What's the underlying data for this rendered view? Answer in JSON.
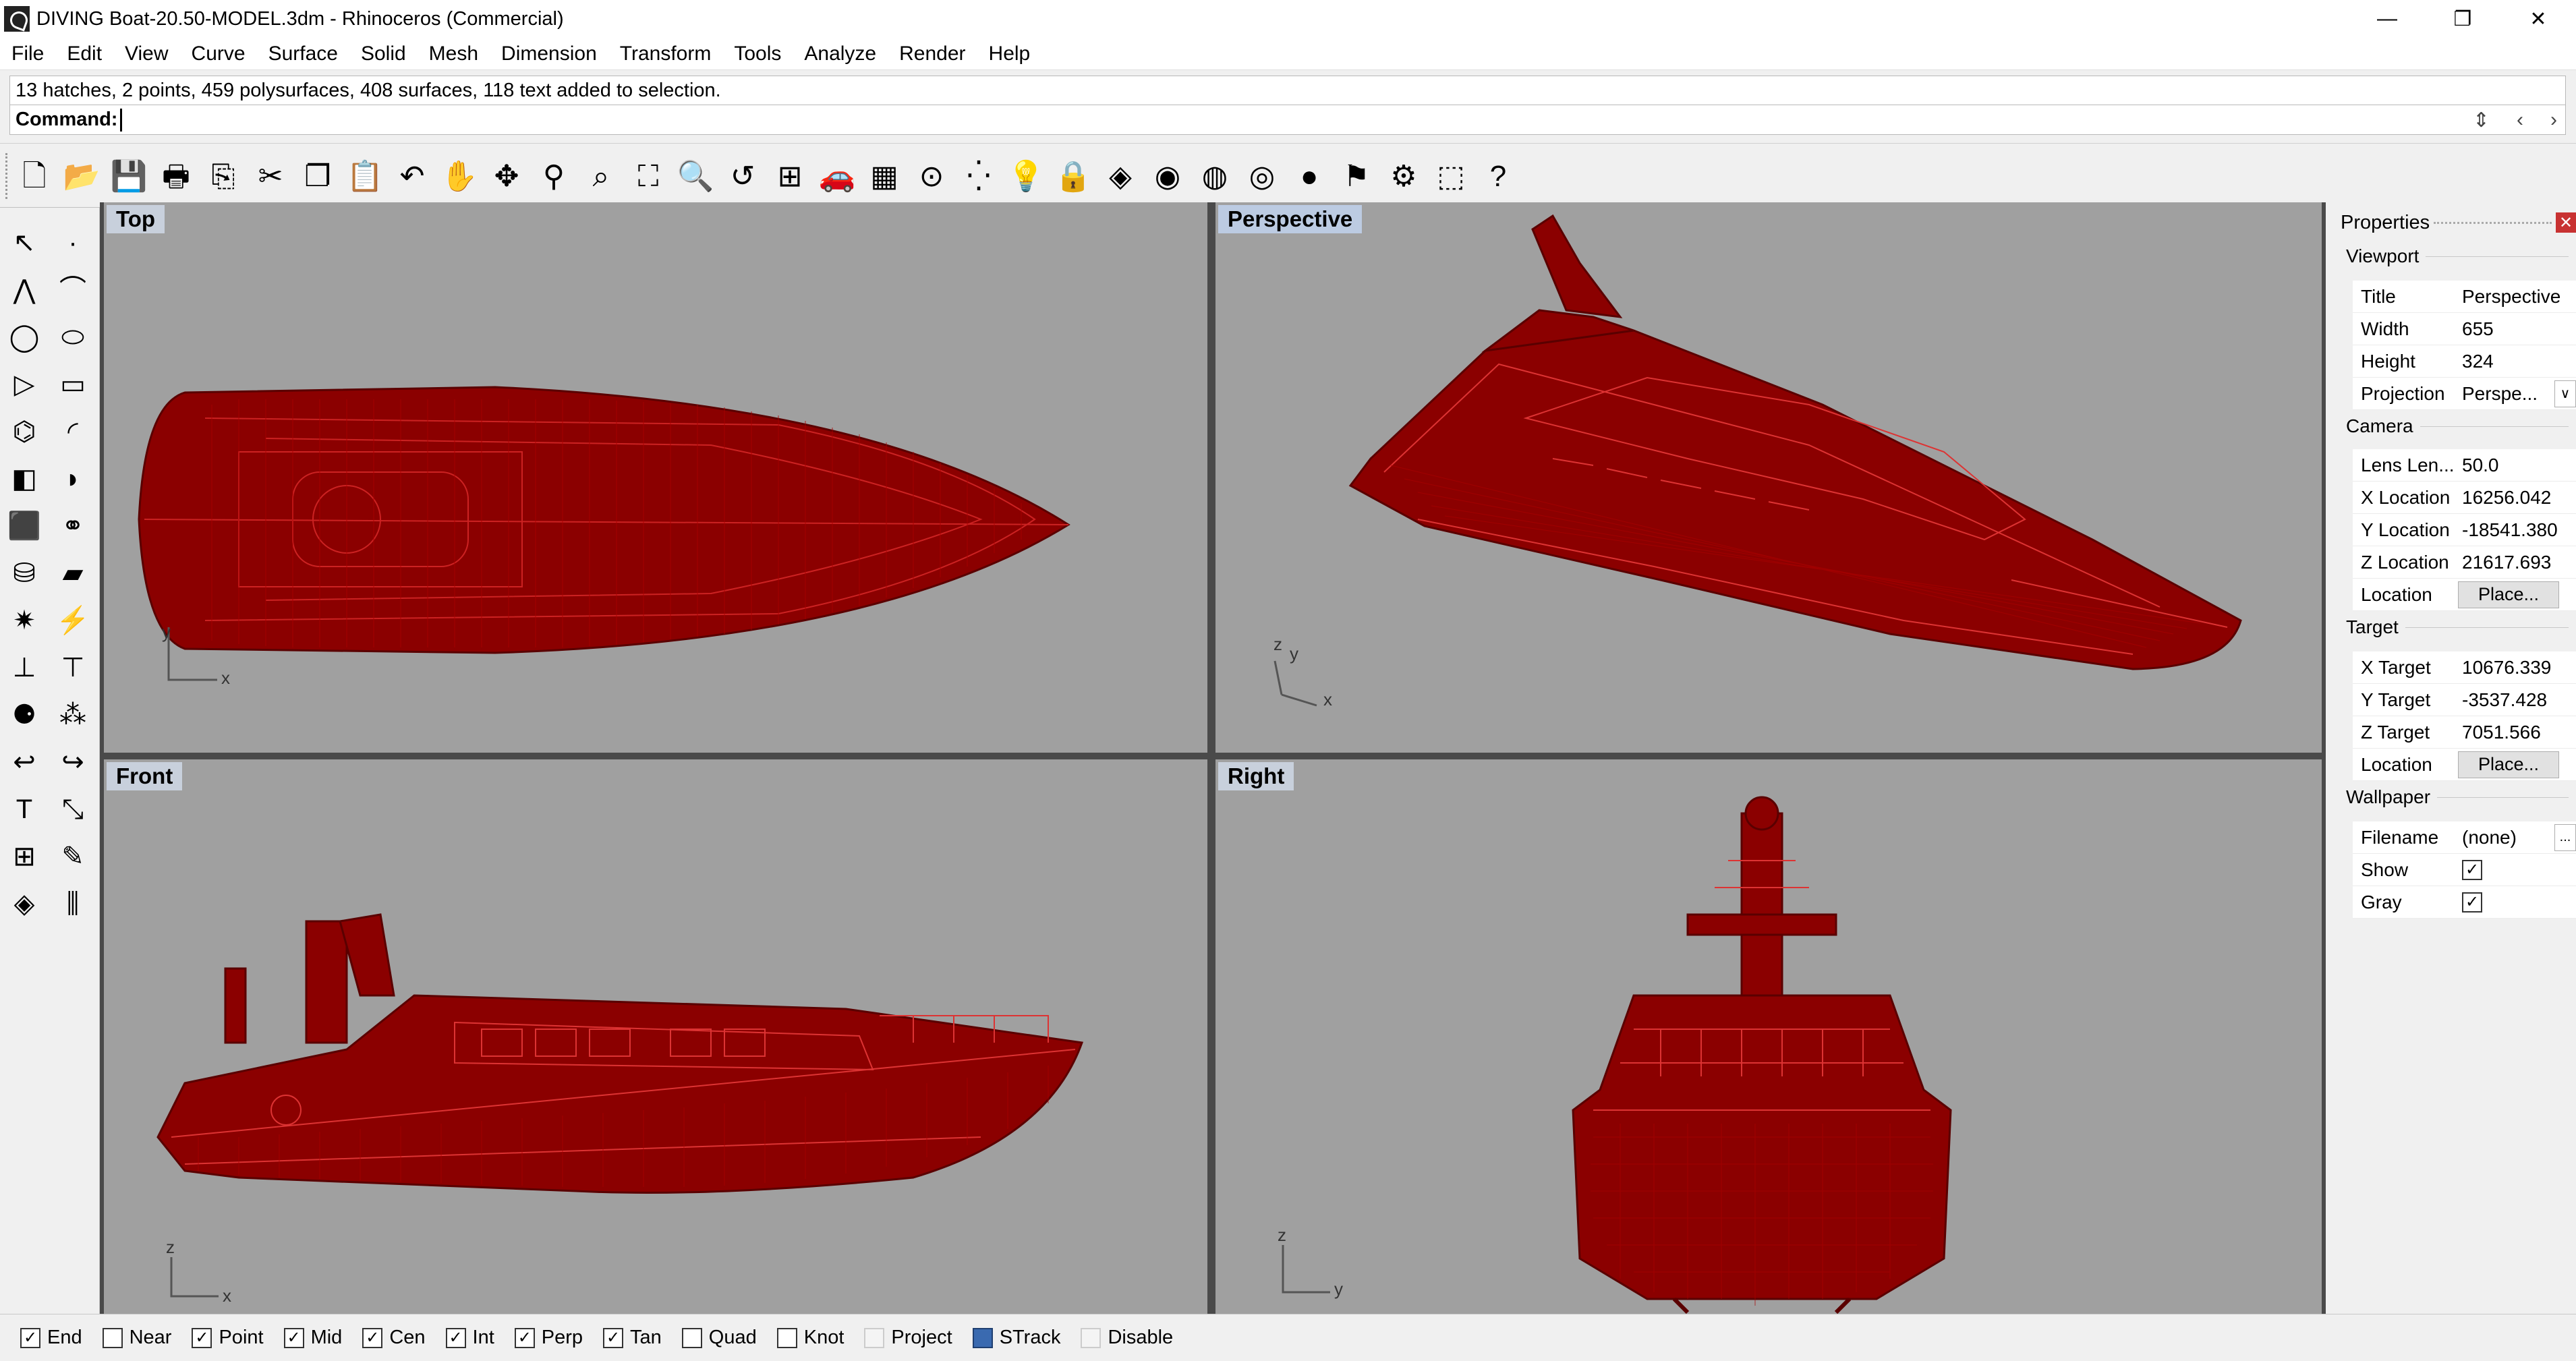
{
  "window": {
    "title": "DIVING Boat-20.50-MODEL.3dm - Rhinoceros (Commercial)",
    "minimize": "—",
    "restore": "❐",
    "close": "✕"
  },
  "menu": [
    "File",
    "Edit",
    "View",
    "Curve",
    "Surface",
    "Solid",
    "Mesh",
    "Dimension",
    "Transform",
    "Tools",
    "Analyze",
    "Render",
    "Help"
  ],
  "command": {
    "history": "13 hatches, 2 points, 459 polysurfaces, 408 surfaces, 118 text added to selection.",
    "label": "Command:",
    "prev": "‹",
    "next": "›",
    "spinner": "⇕"
  },
  "toolbar_icons": [
    "new-icon",
    "open-icon",
    "save-icon",
    "print-icon",
    "import-icon",
    "cut-icon",
    "copy-icon",
    "paste-icon",
    "undo-icon",
    "pan-icon",
    "rotate-view-icon",
    "zoom-icon",
    "zoom-window-icon",
    "zoom-extents-icon",
    "zoom-selected-icon",
    "undo-view-icon",
    "four-viewports-icon",
    "car-icon",
    "grid-icon",
    "osnap-icon",
    "points-icon",
    "light-icon",
    "lock-icon",
    "layer-icon",
    "color-wheel-icon",
    "wireframe-sphere-icon",
    "ghosted-sphere-icon",
    "rendered-sphere-icon",
    "selection-icon",
    "options-icon",
    "structure-icon",
    "help-icon"
  ],
  "toolbar_glyphs": [
    "🗋",
    "📂",
    "💾",
    "🖶",
    "⎘",
    "✂",
    "❐",
    "📋",
    "↶",
    "✋",
    "✥",
    "⚲",
    "⌕",
    "⛶",
    "🔍",
    "↺",
    "⊞",
    "🚗",
    "▦",
    "⊙",
    "⁛",
    "💡",
    "🔒",
    "◈",
    "◉",
    "◍",
    "◎",
    "●",
    "⚑",
    "⚙",
    "⬚",
    "?"
  ],
  "sidebar_icons": [
    {
      "name": "select-icon",
      "glyph": "↖"
    },
    {
      "name": "point-icon",
      "glyph": "·"
    },
    {
      "name": "polyline-icon",
      "glyph": "⋀"
    },
    {
      "name": "curve-icon",
      "glyph": "⌒"
    },
    {
      "name": "circle-icon",
      "glyph": "◯"
    },
    {
      "name": "ellipse-icon",
      "glyph": "⬭"
    },
    {
      "name": "polygon-icon",
      "glyph": "▷"
    },
    {
      "name": "rectangle-icon",
      "glyph": "▭"
    },
    {
      "name": "fillet-icon",
      "glyph": "⌬"
    },
    {
      "name": "arc-icon",
      "glyph": "◜"
    },
    {
      "name": "surface-icon",
      "glyph": "◧"
    },
    {
      "name": "loft-icon",
      "glyph": "◗"
    },
    {
      "name": "box-icon",
      "glyph": "⬛"
    },
    {
      "name": "boolean-icon",
      "glyph": "⚭"
    },
    {
      "name": "cylinder-icon",
      "glyph": "⛁"
    },
    {
      "name": "mesh-icon",
      "glyph": "▰"
    },
    {
      "name": "transform-icon",
      "glyph": "✷"
    },
    {
      "name": "analyze-icon",
      "glyph": "⚡"
    },
    {
      "name": "dimension-icon",
      "glyph": "⊥"
    },
    {
      "name": "text-dim-icon",
      "glyph": "⊤"
    },
    {
      "name": "group-icon",
      "glyph": "⚈"
    },
    {
      "name": "explode-icon",
      "glyph": "⁂"
    },
    {
      "name": "trim-icon",
      "glyph": "↩"
    },
    {
      "name": "split-icon",
      "glyph": "↪"
    },
    {
      "name": "text-icon",
      "glyph": "T"
    },
    {
      "name": "scale-icon",
      "glyph": "⤡"
    },
    {
      "name": "array-icon",
      "glyph": "⊞"
    },
    {
      "name": "edit-icon",
      "glyph": "✎"
    },
    {
      "name": "render-icon",
      "glyph": "◈"
    },
    {
      "name": "contour-icon",
      "glyph": "⫼"
    }
  ],
  "viewports": {
    "top": {
      "label": "Top",
      "ax1": "y",
      "ax2": "x"
    },
    "perspective": {
      "label": "Perspective",
      "ax1": "z",
      "ax2": "y",
      "ax3": "x"
    },
    "front": {
      "label": "Front",
      "ax1": "z",
      "ax2": "x"
    },
    "right": {
      "label": "Right",
      "ax1": "z",
      "ax2": "y"
    }
  },
  "properties": {
    "title": "Properties",
    "close": "✕",
    "viewport_section": "Viewport",
    "rows_viewport": [
      {
        "k": "Title",
        "v": "Perspective"
      },
      {
        "k": "Width",
        "v": "655"
      },
      {
        "k": "Height",
        "v": "324"
      },
      {
        "k": "Projection",
        "v": "Perspe..."
      }
    ],
    "projection_dropdown": "∨",
    "camera_section": "Camera",
    "rows_camera": [
      {
        "k": "Lens Len...",
        "v": "50.0"
      },
      {
        "k": "X Location",
        "v": "16256.042"
      },
      {
        "k": "Y Location",
        "v": "-18541.380"
      },
      {
        "k": "Z Location",
        "v": "21617.693"
      }
    ],
    "location_label": "Location",
    "place_button": "Place...",
    "target_section": "Target",
    "rows_target": [
      {
        "k": "X Target",
        "v": "10676.339"
      },
      {
        "k": "Y Target",
        "v": "-3537.428"
      },
      {
        "k": "Z Target",
        "v": "7051.566"
      }
    ],
    "wallpaper_section": "Wallpaper",
    "filename_label": "Filename",
    "filename_value": "(none)",
    "browse_button": "...",
    "show_label": "Show",
    "gray_label": "Gray",
    "check": "✓"
  },
  "osnaps": [
    {
      "label": "End",
      "checked": true
    },
    {
      "label": "Near",
      "checked": false
    },
    {
      "label": "Point",
      "checked": true
    },
    {
      "label": "Mid",
      "checked": true
    },
    {
      "label": "Cen",
      "checked": true
    },
    {
      "label": "Int",
      "checked": true
    },
    {
      "label": "Perp",
      "checked": true
    },
    {
      "label": "Tan",
      "checked": true
    },
    {
      "label": "Quad",
      "checked": false
    },
    {
      "label": "Knot",
      "checked": false
    },
    {
      "label": "Project",
      "checked": false
    },
    {
      "label": "STrack",
      "checked": false
    },
    {
      "label": "Disable",
      "checked": false
    }
  ],
  "colors": {
    "model": "#8b0000",
    "viewport_bg": "#a0a0a0",
    "label_bg": "#c8d0dc"
  }
}
